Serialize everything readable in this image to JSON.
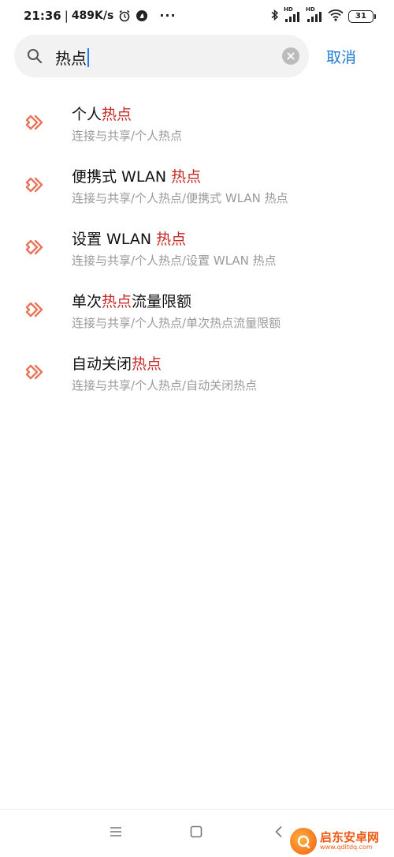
{
  "status_bar": {
    "time": "21:36",
    "separator": "|",
    "speed": "489K/s",
    "more": "···",
    "hd_label_1": "HD",
    "hd_label_2": "HD",
    "battery": "31"
  },
  "search": {
    "query": "热点"
  },
  "cancel_label": "取消",
  "results": [
    {
      "title_before": "个人",
      "title_highlight": "热点",
      "title_after": "",
      "path": "连接与共享/个人热点"
    },
    {
      "title_before": "便携式 WLAN ",
      "title_highlight": "热点",
      "title_after": "",
      "path": "连接与共享/个人热点/便携式 WLAN 热点"
    },
    {
      "title_before": "设置 WLAN ",
      "title_highlight": "热点",
      "title_after": "",
      "path": "连接与共享/个人热点/设置 WLAN 热点"
    },
    {
      "title_before": "单次",
      "title_highlight": "热点",
      "title_after": "流量限额",
      "path": "连接与共享/个人热点/单次热点流量限额"
    },
    {
      "title_before": "自动关闭",
      "title_highlight": "热点",
      "title_after": "",
      "path": "连接与共享/个人热点/自动关闭热点"
    }
  ],
  "watermark": {
    "name": "启东安卓网",
    "url": "www.qdltdq.com"
  },
  "colors": {
    "highlight": "#c62a27",
    "accent": "#1e7bd2",
    "result_icon": "#e8755a"
  }
}
